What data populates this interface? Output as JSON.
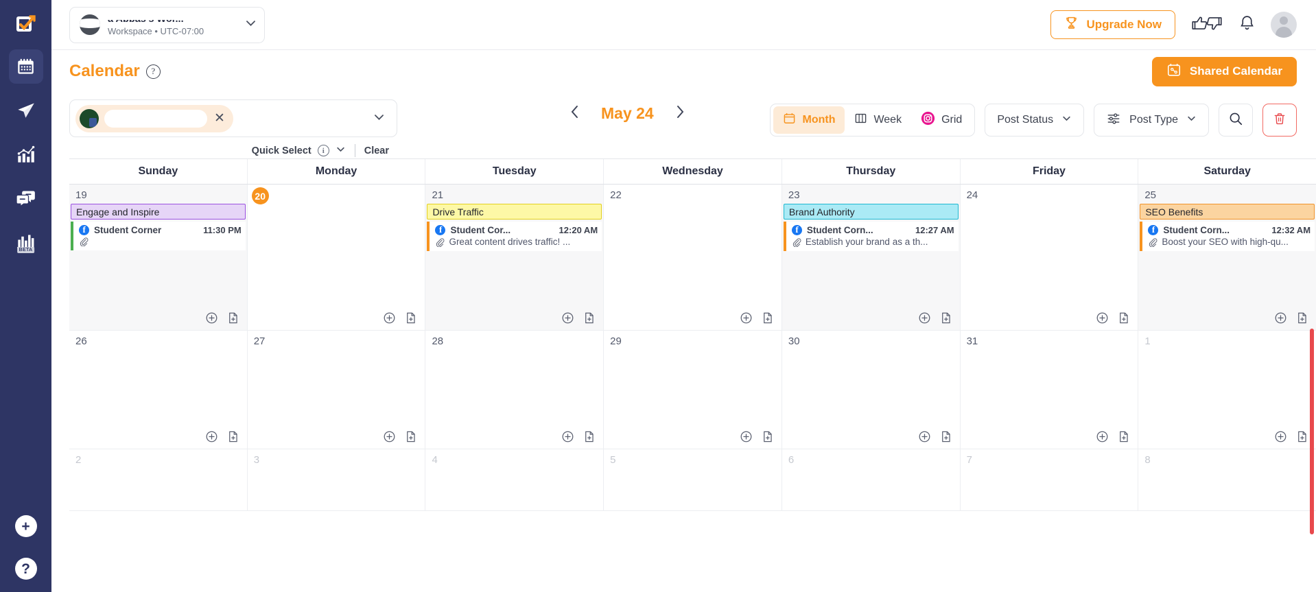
{
  "colors": {
    "sidebar": "#2e3564",
    "accent": "#f7931e",
    "danger": "#e8494c",
    "facebook": "#1877f2",
    "instagram": "#e8158f"
  },
  "sidebar": {
    "logo_icon": "checkbox-arrow-logo-icon",
    "items": [
      {
        "icon": "calendar-icon",
        "name": "calendar",
        "active": true
      },
      {
        "icon": "paper-plane-icon",
        "name": "publish",
        "active": false
      },
      {
        "icon": "analytics-chart-icon",
        "name": "analytics",
        "active": false
      },
      {
        "icon": "chat-bubbles-icon",
        "name": "engage",
        "active": false
      },
      {
        "icon": "bar-chart-icon",
        "name": "reports",
        "active": false,
        "badge": "BETA"
      }
    ],
    "bottom": [
      {
        "icon": "plus-icon",
        "label": "+",
        "name": "add"
      },
      {
        "icon": "question-mark-icon",
        "label": "?",
        "name": "help"
      }
    ]
  },
  "topbar": {
    "workspace": {
      "name": "a Abbas's Wor...",
      "subtitle": "Workspace • UTC-07:00",
      "avatar_icon": "workspace-avatar",
      "chevron_icon": "chevron-down-icon"
    },
    "upgrade_label": "Upgrade Now",
    "upgrade_icon": "trophy-icon",
    "thumbs_up_icon": "thumbs-up-icon",
    "thumbs_down_icon": "thumbs-down-icon",
    "bell_icon": "bell-icon",
    "avatar_icon": "user-avatar-icon"
  },
  "pagehead": {
    "title": "Calendar",
    "help_icon": "question-circle-icon",
    "shared_label": "Shared Calendar",
    "shared_icon": "shared-calendar-icon"
  },
  "toolbar": {
    "profile_select": {
      "chip_label": "",
      "clear_icon": "close-icon",
      "chevron_icon": "chevron-down-icon"
    },
    "quick_select_label": "Quick Select",
    "quick_select_info_icon": "info-icon",
    "quick_select_chevron_icon": "chevron-down-icon",
    "clear_label": "Clear",
    "month_nav": {
      "prev_icon": "chevron-left-icon",
      "label": "May 24",
      "next_icon": "chevron-right-icon"
    },
    "view_modes": [
      {
        "label": "Month",
        "icon": "calendar-icon",
        "active": true
      },
      {
        "label": "Week",
        "icon": "columns-icon",
        "active": false
      },
      {
        "label": "Grid",
        "icon": "instagram-icon",
        "active": false
      }
    ],
    "post_status": {
      "label": "Post Status",
      "chevron_icon": "chevron-down-icon"
    },
    "post_type": {
      "label": "Post Type",
      "icon": "sliders-icon",
      "chevron_icon": "chevron-down-icon"
    },
    "search_icon": "search-icon",
    "delete_icon": "trash-icon"
  },
  "calendar": {
    "weekdays": [
      "Sunday",
      "Monday",
      "Tuesday",
      "Wednesday",
      "Thursday",
      "Friday",
      "Saturday"
    ],
    "add_post_icon": "plus-circle-icon",
    "add_note_icon": "file-plus-icon",
    "attachment_icon": "paperclip-icon",
    "rows": [
      {
        "days": [
          {
            "num": "19",
            "today": false,
            "muted": false,
            "campaign": {
              "label": "Engage and Inspire",
              "bg": "#e6d5f7",
              "border": "#9b51e0"
            },
            "posts": [
              {
                "network_icon": "facebook-icon",
                "name": "Student Corner",
                "time": "11:30 PM",
                "text": "",
                "accent": "#4caf50",
                "has_attachment": true
              }
            ]
          },
          {
            "num": "20",
            "today": true,
            "muted": false,
            "campaign": null,
            "posts": []
          },
          {
            "num": "21",
            "today": false,
            "muted": false,
            "campaign": {
              "label": "Drive Traffic",
              "bg": "#fdf8a6",
              "border": "#e3d01f"
            },
            "posts": [
              {
                "network_icon": "facebook-icon",
                "name": "Student Cor...",
                "time": "12:20 AM",
                "text": "Great content drives traffic! ...",
                "accent": "#f7931e",
                "has_attachment": true
              }
            ]
          },
          {
            "num": "22",
            "today": false,
            "muted": false,
            "campaign": null,
            "posts": []
          },
          {
            "num": "23",
            "today": false,
            "muted": false,
            "campaign": {
              "label": "Brand Authority",
              "bg": "#aaeaf5",
              "border": "#1eb8d0"
            },
            "posts": [
              {
                "network_icon": "facebook-icon",
                "name": "Student Corn...",
                "time": "12:27 AM",
                "text": "Establish your brand as a th...",
                "accent": "#f7931e",
                "has_attachment": true
              }
            ]
          },
          {
            "num": "24",
            "today": false,
            "muted": false,
            "campaign": null,
            "posts": []
          },
          {
            "num": "25",
            "today": false,
            "muted": false,
            "campaign": {
              "label": "SEO Benefits",
              "bg": "#fbd4a0",
              "border": "#f0932b"
            },
            "posts": [
              {
                "network_icon": "facebook-icon",
                "name": "Student Corn...",
                "time": "12:32 AM",
                "text": "Boost your SEO with high-qu...",
                "accent": "#f7931e",
                "has_attachment": true
              }
            ]
          }
        ]
      },
      {
        "days": [
          {
            "num": "26",
            "today": false,
            "muted": false,
            "campaign": null,
            "posts": []
          },
          {
            "num": "27",
            "today": false,
            "muted": false,
            "campaign": null,
            "posts": []
          },
          {
            "num": "28",
            "today": false,
            "muted": false,
            "campaign": null,
            "posts": []
          },
          {
            "num": "29",
            "today": false,
            "muted": false,
            "campaign": null,
            "posts": []
          },
          {
            "num": "30",
            "today": false,
            "muted": false,
            "campaign": null,
            "posts": []
          },
          {
            "num": "31",
            "today": false,
            "muted": false,
            "campaign": null,
            "posts": []
          },
          {
            "num": "1",
            "today": false,
            "muted": true,
            "campaign": null,
            "posts": []
          }
        ]
      },
      {
        "days": [
          {
            "num": "2",
            "today": false,
            "muted": true,
            "campaign": null,
            "posts": []
          },
          {
            "num": "3",
            "today": false,
            "muted": true,
            "campaign": null,
            "posts": []
          },
          {
            "num": "4",
            "today": false,
            "muted": true,
            "campaign": null,
            "posts": []
          },
          {
            "num": "5",
            "today": false,
            "muted": true,
            "campaign": null,
            "posts": []
          },
          {
            "num": "6",
            "today": false,
            "muted": true,
            "campaign": null,
            "posts": []
          },
          {
            "num": "7",
            "today": false,
            "muted": true,
            "campaign": null,
            "posts": []
          },
          {
            "num": "8",
            "today": false,
            "muted": true,
            "campaign": null,
            "posts": []
          }
        ]
      }
    ]
  }
}
